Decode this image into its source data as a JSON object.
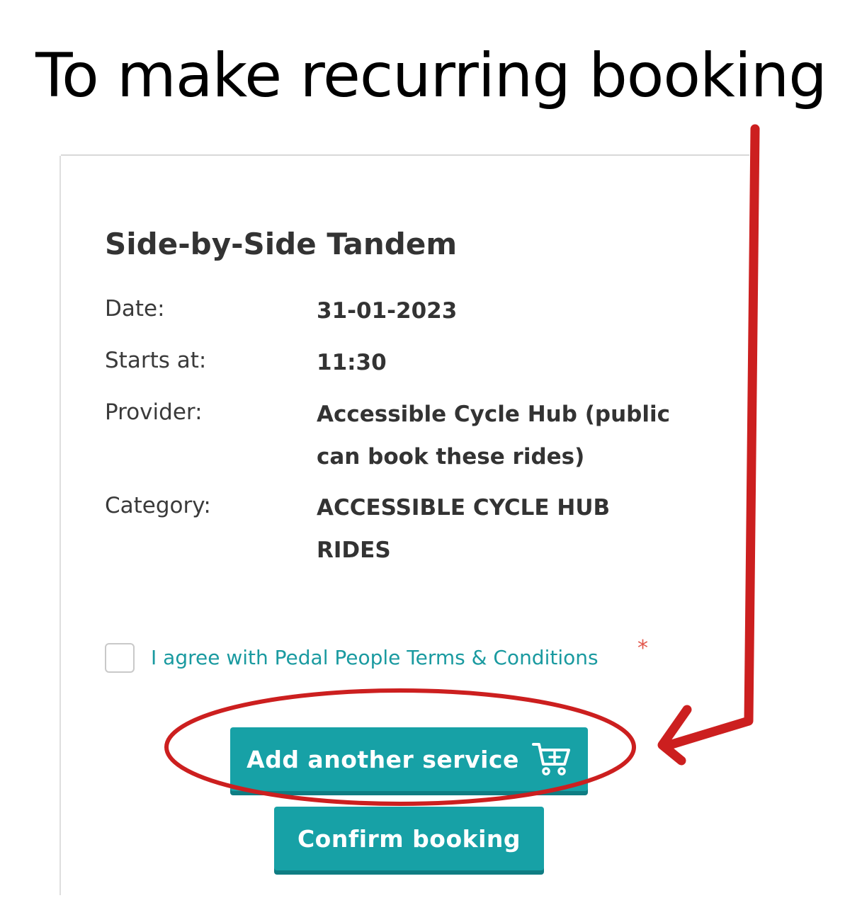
{
  "headline": "To make recurring booking",
  "summary": {
    "title": "Side-by-Side Tandem",
    "rows": [
      {
        "label": "Date:",
        "value": "31-01-2023"
      },
      {
        "label": "Starts at:",
        "value": "11:30"
      },
      {
        "label": "Provider:",
        "value": "Accessible Cycle Hub (public can book these rides)"
      },
      {
        "label": "Category:",
        "value": "ACCESSIBLE CYCLE HUB RIDES"
      }
    ]
  },
  "terms": {
    "label": "I agree with Pedal People Terms & Conditions",
    "required_mark": "*",
    "checked": false
  },
  "buttons": {
    "add_service": "Add another service",
    "confirm": "Confirm booking"
  },
  "icons": {
    "add_service": "cart-plus-icon"
  },
  "colors": {
    "accent": "#17a1a6",
    "link": "#1a9aa0",
    "annotation": "#cc1f1f",
    "required": "#e2574c"
  }
}
